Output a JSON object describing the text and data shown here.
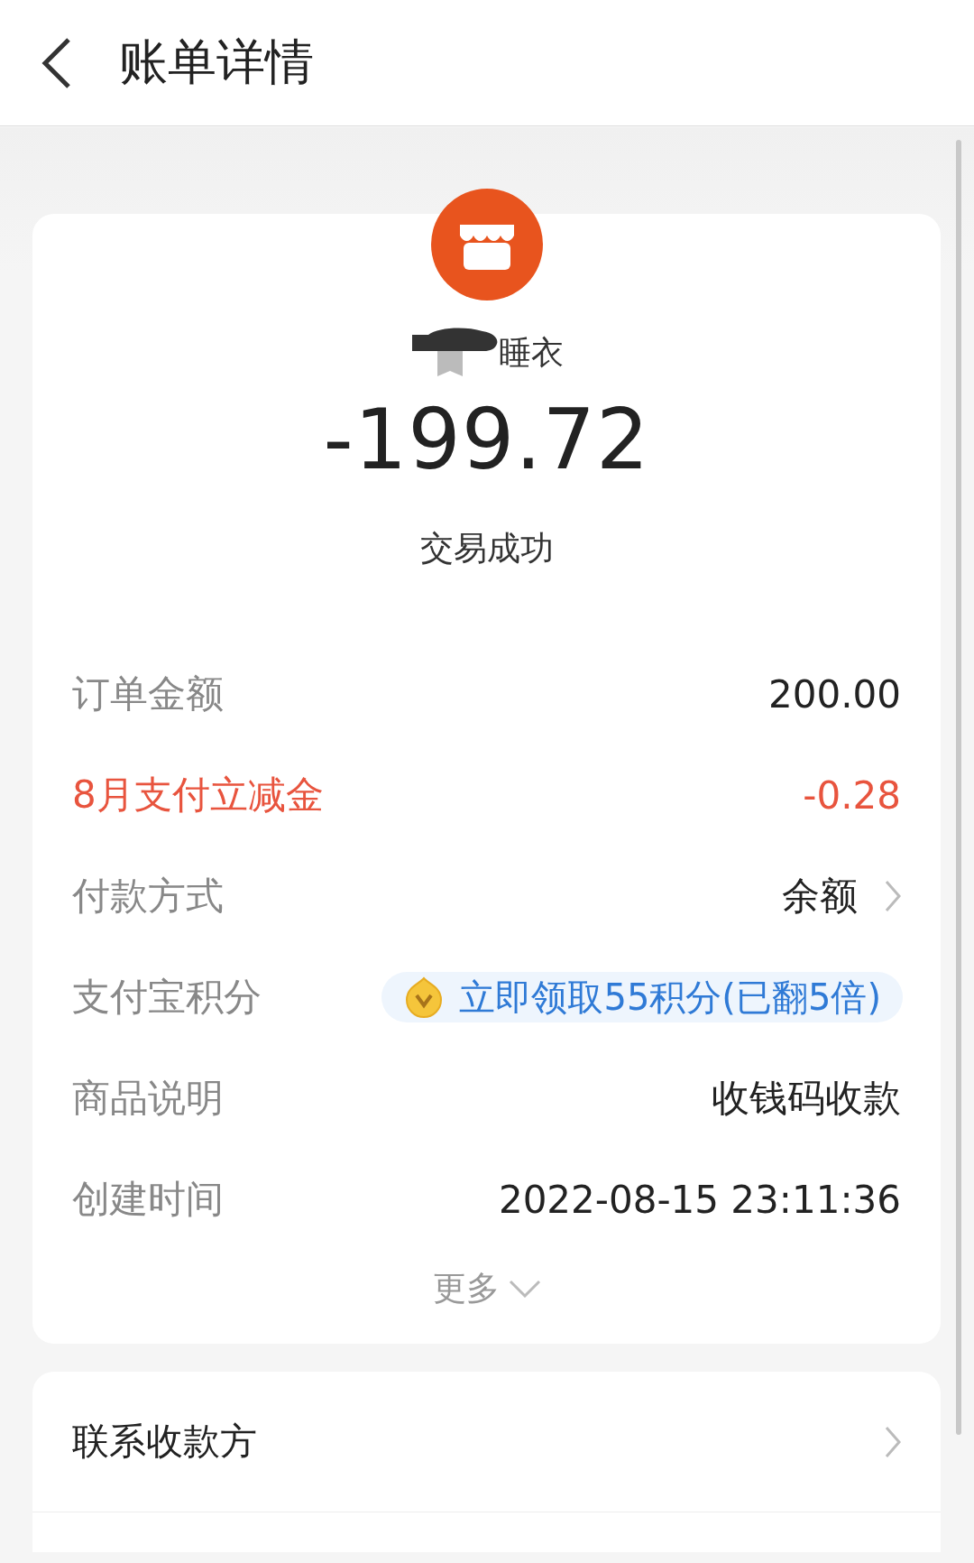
{
  "header": {
    "title": "账单详情"
  },
  "merchant": {
    "name": "睡衣",
    "redacted": true
  },
  "amount": "-199.72",
  "status": "交易成功",
  "details": [
    {
      "kind": "plain",
      "label": "订单金额",
      "value": "200.00"
    },
    {
      "kind": "highlight",
      "label": "8月支付立减金",
      "value": "-0.28"
    },
    {
      "kind": "link",
      "label": "付款方式",
      "value": "余额"
    },
    {
      "kind": "badge",
      "label": "支付宝积分",
      "value": "立即领取55积分(已翻5倍)"
    },
    {
      "kind": "plain",
      "label": "商品说明",
      "value": "收钱码收款"
    },
    {
      "kind": "plain",
      "label": "创建时间",
      "value": "2022-08-15 23:11:36"
    }
  ],
  "more": {
    "label": "更多",
    "expanded": false
  },
  "actions": [
    {
      "label": "联系收款方"
    }
  ]
}
